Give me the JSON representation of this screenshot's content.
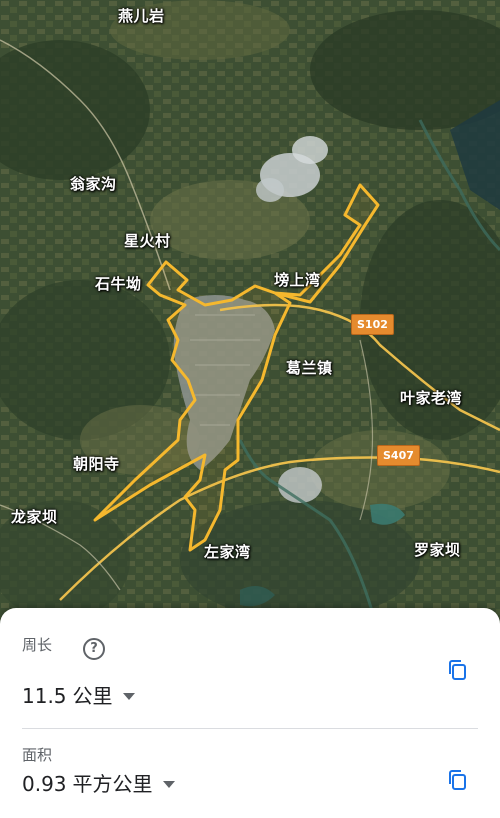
{
  "map": {
    "labels": {
      "yanerya": "燕儿岩",
      "wengjiagou": "翁家沟",
      "xinghuocun": "星火村",
      "shiniuao": "石牛坳",
      "bangshangwan": "塝上湾",
      "gelanzhen": "葛兰镇",
      "yejialaowan": "叶家老湾",
      "chaoyangsi": "朝阳寺",
      "longjiaba": "龙家坝",
      "zuojiawan": "左家湾",
      "luojiaba": "罗家坝"
    },
    "roads": {
      "s102": "S102",
      "s407": "S407"
    },
    "boundary_color": "#f5b82e"
  },
  "measure": {
    "perimeter_label": "周长",
    "perimeter_value": "11.5",
    "perimeter_unit": "公里",
    "area_label": "面积",
    "area_value": "0.93",
    "area_unit": "平方公里"
  },
  "icons": {
    "help": "help-circle-icon",
    "dropdown": "dropdown-arrow-icon",
    "copy": "copy-icon"
  },
  "colors": {
    "sheet_bg": "#ffffff",
    "accent": "#1a73e8"
  }
}
